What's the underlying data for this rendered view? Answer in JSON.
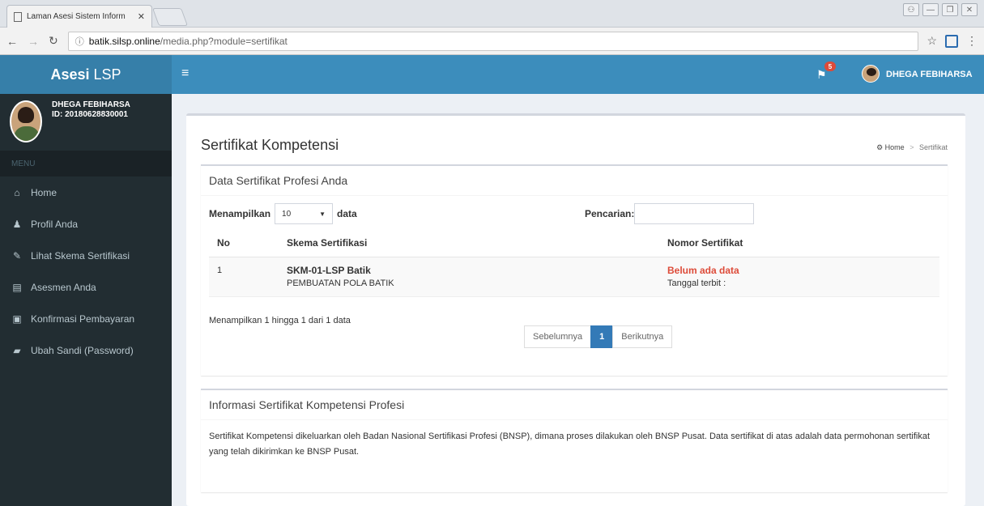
{
  "browser": {
    "tab_title": "Laman Asesi Sistem Inform",
    "url_host": "batik.silsp.online",
    "url_path": "/media.php?module=sertifikat"
  },
  "app": {
    "brand_bold": "Asesi",
    "brand_rest": "LSP",
    "notif_count": "5",
    "user_name": "DHEGA FEBIHARSA",
    "user_id": "ID: 20180628830001",
    "menu_heading": "MENU"
  },
  "sidebar": {
    "items": [
      {
        "label": "Home",
        "icon": "home-icon"
      },
      {
        "label": "Profil Anda",
        "icon": "user-icon"
      },
      {
        "label": "Lihat Skema Sertifikasi",
        "icon": "edit-icon"
      },
      {
        "label": "Asesmen Anda",
        "icon": "file-icon"
      },
      {
        "label": "Konfirmasi Pembayaran",
        "icon": "money-icon"
      },
      {
        "label": "Ubah Sandi (Password)",
        "icon": "lock-icon"
      }
    ]
  },
  "page": {
    "title": "Sertifikat Kompetensi",
    "breadcrumb_home": "Home",
    "breadcrumb_current": "Sertifikat"
  },
  "certificates": {
    "panel_title": "Data Sertifikat Profesi Anda",
    "length_label_pre": "Menampilkan",
    "length_value": "10",
    "length_label_post": "data",
    "search_label": "Pencarian:",
    "columns": [
      "No",
      "Skema Sertifikasi",
      "Nomor Sertifikat"
    ],
    "rows": [
      {
        "no": "1",
        "skema_code": "SKM-01-LSP Batik",
        "skema_name": "PEMBUATAN POLA BATIK",
        "nomor": "Belum ada data",
        "tanggal": "Tanggal terbit :"
      }
    ],
    "info": "Menampilkan 1 hingga 1 dari 1 data",
    "pager": {
      "prev": "Sebelumnya",
      "current": "1",
      "next": "Berikutnya"
    }
  },
  "info_panel": {
    "title": "Informasi Sertifikat Kompetensi Profesi",
    "text": "Sertifikat Kompetensi dikeluarkan oleh Badan Nasional Sertifikasi Profesi (BNSP), dimana proses dilakukan oleh BNSP Pusat. Data sertifikat di atas adalah data permohonan sertifikat yang telah dikirimkan ke BNSP Pusat."
  },
  "colors": {
    "header": "#3c8dbc",
    "brand": "#367fa9",
    "sidebar": "#222d32",
    "accent_red": "#dd4b39",
    "pager_active": "#337ab7"
  }
}
